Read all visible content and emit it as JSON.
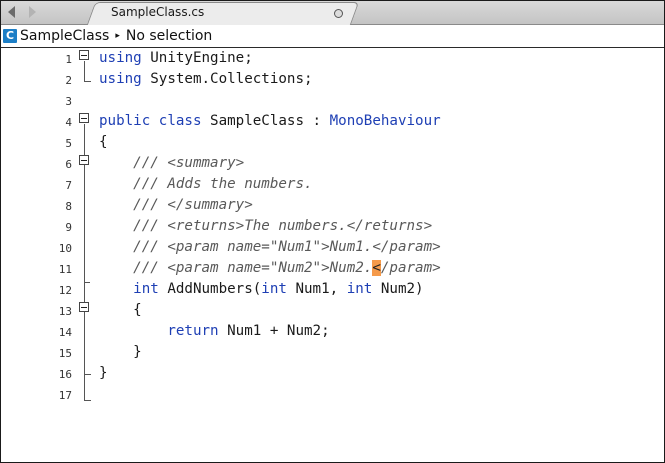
{
  "tab": {
    "title": "SampleClass.cs"
  },
  "path": {
    "class_name": "SampleClass",
    "separator": "▸",
    "member": "No selection"
  },
  "lines": [
    {
      "num": "1",
      "segments": [
        {
          "t": "using",
          "c": "kw"
        },
        {
          "t": " UnityEngine;",
          "c": ""
        }
      ]
    },
    {
      "num": "2",
      "segments": [
        {
          "t": "using",
          "c": "kw"
        },
        {
          "t": " System.Collections;",
          "c": ""
        }
      ]
    },
    {
      "num": "3",
      "segments": []
    },
    {
      "num": "4",
      "segments": [
        {
          "t": "public",
          "c": "kw"
        },
        {
          "t": " ",
          "c": ""
        },
        {
          "t": "class",
          "c": "kw"
        },
        {
          "t": " SampleClass : ",
          "c": ""
        },
        {
          "t": "MonoBehaviour",
          "c": "ty"
        }
      ]
    },
    {
      "num": "5",
      "segments": [
        {
          "t": "{",
          "c": ""
        }
      ]
    },
    {
      "num": "6",
      "segments": [
        {
          "t": "    /// <summary>",
          "c": "cm"
        }
      ]
    },
    {
      "num": "7",
      "segments": [
        {
          "t": "    /// Adds the numbers.",
          "c": "cm"
        }
      ]
    },
    {
      "num": "8",
      "segments": [
        {
          "t": "    /// </summary>",
          "c": "cm"
        }
      ]
    },
    {
      "num": "9",
      "segments": [
        {
          "t": "    /// <returns>The numbers.</returns>",
          "c": "cm"
        }
      ]
    },
    {
      "num": "10",
      "segments": [
        {
          "t": "    /// <param name=\"Num1\">Num1.</param>",
          "c": "cm"
        }
      ]
    },
    {
      "num": "11",
      "segments": [
        {
          "t": "    /// <param name=\"Num2\">Num2.",
          "c": "cm"
        },
        {
          "t": "<",
          "c": "cur"
        },
        {
          "t": "/param>",
          "c": "cm"
        }
      ]
    },
    {
      "num": "12",
      "segments": [
        {
          "t": "    ",
          "c": ""
        },
        {
          "t": "int",
          "c": "kw"
        },
        {
          "t": " AddNumbers(",
          "c": ""
        },
        {
          "t": "int",
          "c": "kw"
        },
        {
          "t": " Num1, ",
          "c": ""
        },
        {
          "t": "int",
          "c": "kw"
        },
        {
          "t": " Num2)",
          "c": ""
        }
      ]
    },
    {
      "num": "13",
      "segments": [
        {
          "t": "    {",
          "c": ""
        }
      ]
    },
    {
      "num": "14",
      "segments": [
        {
          "t": "        ",
          "c": ""
        },
        {
          "t": "return",
          "c": "kw"
        },
        {
          "t": " Num1 + Num2;",
          "c": ""
        }
      ]
    },
    {
      "num": "15",
      "segments": [
        {
          "t": "    }",
          "c": ""
        }
      ]
    },
    {
      "num": "16",
      "segments": [
        {
          "t": "}",
          "c": ""
        }
      ]
    },
    {
      "num": "17",
      "segments": []
    }
  ]
}
